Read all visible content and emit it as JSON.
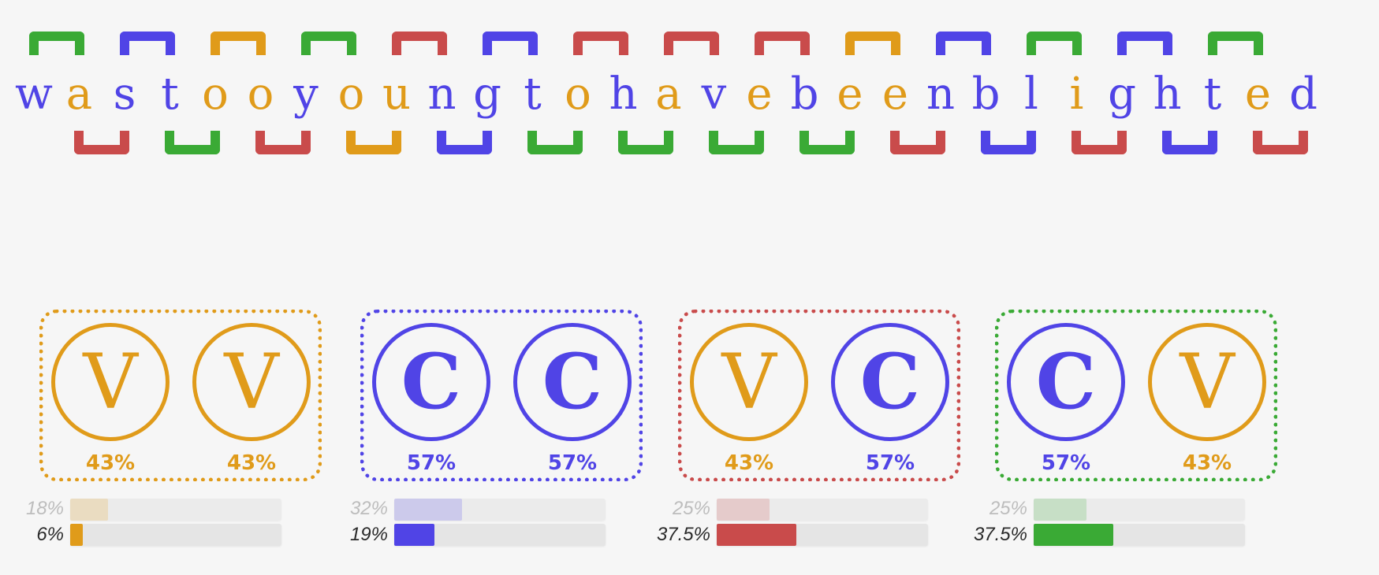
{
  "colors": {
    "vowel": "#e09b1a",
    "consonant": "#5044e6",
    "red": "#c94b4b",
    "green": "#3aaa35",
    "orange": "#e09b1a",
    "blue": "#5044e6"
  },
  "sentence": {
    "letters": [
      {
        "char": "w",
        "type": "consonant"
      },
      {
        "char": "a",
        "type": "vowel"
      },
      {
        "char": "s",
        "type": "consonant"
      },
      {
        "char": "t",
        "type": "consonant"
      },
      {
        "char": "o",
        "type": "vowel"
      },
      {
        "char": "o",
        "type": "vowel"
      },
      {
        "char": "y",
        "type": "consonant"
      },
      {
        "char": "o",
        "type": "vowel"
      },
      {
        "char": "u",
        "type": "vowel"
      },
      {
        "char": "n",
        "type": "consonant"
      },
      {
        "char": "g",
        "type": "consonant"
      },
      {
        "char": "t",
        "type": "consonant"
      },
      {
        "char": "o",
        "type": "vowel"
      },
      {
        "char": "h",
        "type": "consonant"
      },
      {
        "char": "a",
        "type": "vowel"
      },
      {
        "char": "v",
        "type": "consonant"
      },
      {
        "char": "e",
        "type": "vowel"
      },
      {
        "char": "b",
        "type": "consonant"
      },
      {
        "char": "e",
        "type": "vowel"
      },
      {
        "char": "e",
        "type": "vowel"
      },
      {
        "char": "n",
        "type": "consonant"
      },
      {
        "char": "b",
        "type": "consonant"
      },
      {
        "char": "l",
        "type": "consonant"
      },
      {
        "char": "i",
        "type": "vowel"
      },
      {
        "char": "g",
        "type": "consonant"
      },
      {
        "char": "h",
        "type": "consonant"
      },
      {
        "char": "t",
        "type": "consonant"
      },
      {
        "char": "e",
        "type": "vowel"
      },
      {
        "char": "d",
        "type": "consonant"
      }
    ],
    "top_brackets": [
      "green",
      "blue",
      "orange",
      "green",
      "red",
      "blue",
      "red",
      "red",
      "red",
      "orange",
      "blue",
      "green",
      "blue",
      "green"
    ],
    "bottom_brackets": [
      "red",
      "green",
      "red",
      "orange",
      "blue",
      "green",
      "green",
      "green",
      "green",
      "red",
      "blue",
      "red",
      "blue",
      "red"
    ]
  },
  "pairs": [
    {
      "color": "orange",
      "items": [
        {
          "letter": "V",
          "type": "vowel",
          "percent": "43%"
        },
        {
          "letter": "V",
          "type": "vowel",
          "percent": "43%"
        }
      ],
      "bars": {
        "expected": {
          "label": "18%",
          "value": 0.18
        },
        "actual": {
          "label": "6%",
          "value": 0.06
        }
      }
    },
    {
      "color": "blue",
      "items": [
        {
          "letter": "C",
          "type": "consonant",
          "percent": "57%"
        },
        {
          "letter": "C",
          "type": "consonant",
          "percent": "57%"
        }
      ],
      "bars": {
        "expected": {
          "label": "32%",
          "value": 0.32
        },
        "actual": {
          "label": "19%",
          "value": 0.19
        }
      }
    },
    {
      "color": "red",
      "items": [
        {
          "letter": "V",
          "type": "vowel",
          "percent": "43%"
        },
        {
          "letter": "C",
          "type": "consonant",
          "percent": "57%"
        }
      ],
      "bars": {
        "expected": {
          "label": "25%",
          "value": 0.25
        },
        "actual": {
          "label": "37.5%",
          "value": 0.375
        }
      }
    },
    {
      "color": "green",
      "items": [
        {
          "letter": "C",
          "type": "consonant",
          "percent": "57%"
        },
        {
          "letter": "V",
          "type": "vowel",
          "percent": "43%"
        }
      ],
      "bars": {
        "expected": {
          "label": "25%",
          "value": 0.25
        },
        "actual": {
          "label": "37.5%",
          "value": 0.375
        }
      }
    }
  ]
}
